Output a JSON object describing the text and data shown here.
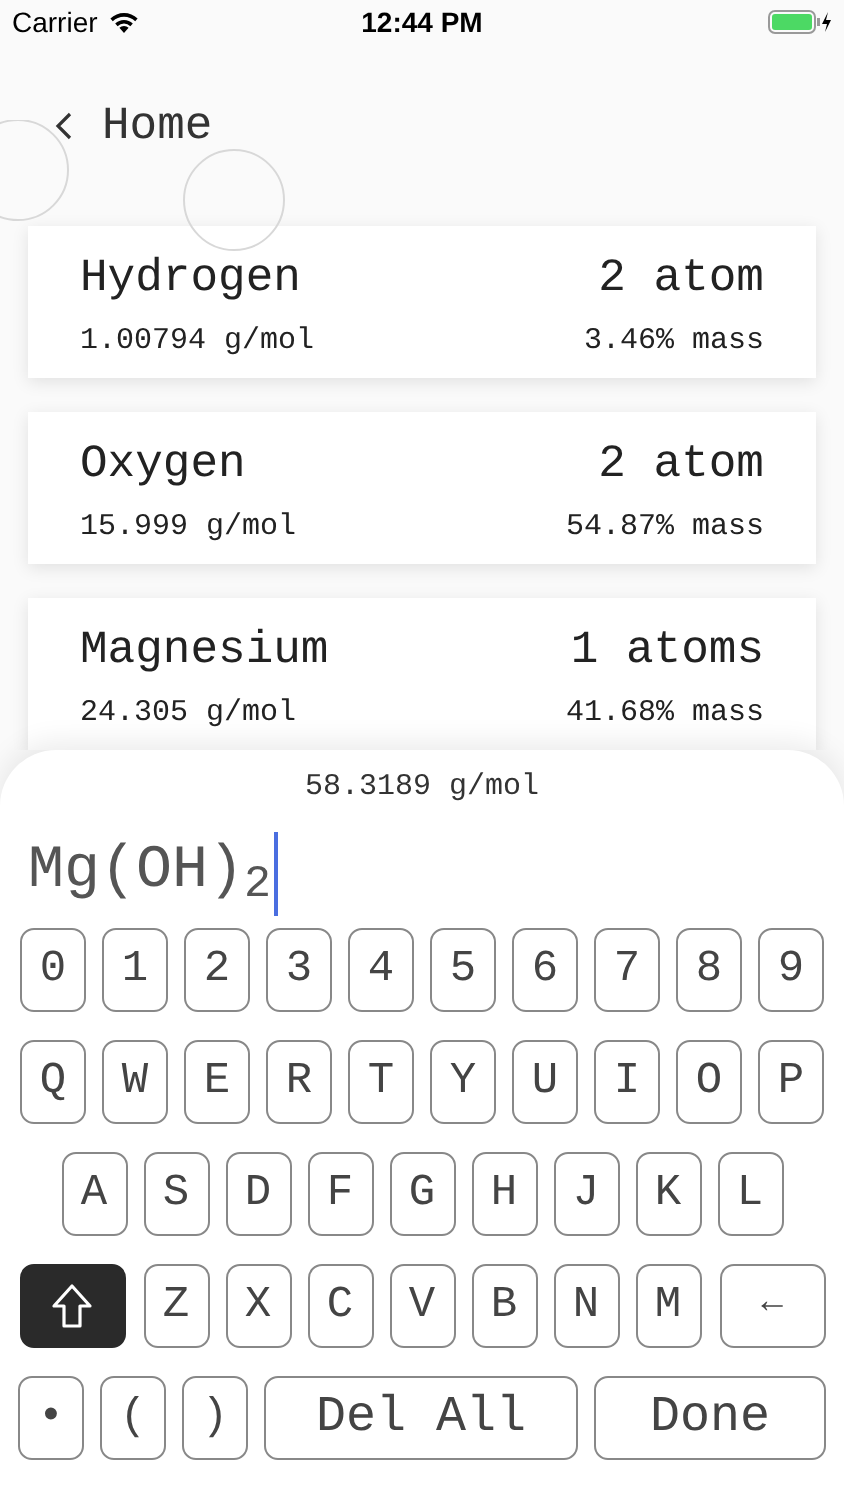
{
  "status_bar": {
    "carrier": "Carrier",
    "time": "12:44 PM"
  },
  "nav": {
    "back_label": "Home"
  },
  "elements": [
    {
      "name": "Hydrogen",
      "molar_mass": "1.00794 g/mol",
      "atoms": "2 atom",
      "mass_share": "3.46% mass"
    },
    {
      "name": "Oxygen",
      "molar_mass": "15.999 g/mol",
      "atoms": "2 atom",
      "mass_share": "54.87% mass"
    },
    {
      "name": "Magnesium",
      "molar_mass": "24.305 g/mol",
      "atoms": "1 atoms",
      "mass_share": "41.68% mass"
    }
  ],
  "total_mass": "58.3189 g/mol",
  "formula": "Mg(OH)$_{2}$",
  "keyboard": [
    [
      {
        "kind": "char",
        "label": "0"
      },
      {
        "kind": "char",
        "label": "1"
      },
      {
        "kind": "char",
        "label": "2"
      },
      {
        "kind": "char",
        "label": "3"
      },
      {
        "kind": "char",
        "label": "4"
      },
      {
        "kind": "char",
        "label": "5"
      },
      {
        "kind": "char",
        "label": "6"
      },
      {
        "kind": "char",
        "label": "7"
      },
      {
        "kind": "char",
        "label": "8"
      },
      {
        "kind": "char",
        "label": "9"
      }
    ],
    [
      {
        "kind": "char",
        "label": "Q"
      },
      {
        "kind": "char",
        "label": "W"
      },
      {
        "kind": "char",
        "label": "E"
      },
      {
        "kind": "char",
        "label": "R"
      },
      {
        "kind": "char",
        "label": "T"
      },
      {
        "kind": "char",
        "label": "Y"
      },
      {
        "kind": "char",
        "label": "U"
      },
      {
        "kind": "char",
        "label": "I"
      },
      {
        "kind": "char",
        "label": "O"
      },
      {
        "kind": "char",
        "label": "P"
      }
    ],
    [
      {
        "kind": "char",
        "label": "A"
      },
      {
        "kind": "char",
        "label": "S"
      },
      {
        "kind": "char",
        "label": "D"
      },
      {
        "kind": "char",
        "label": "F"
      },
      {
        "kind": "char",
        "label": "G"
      },
      {
        "kind": "char",
        "label": "H"
      },
      {
        "kind": "char",
        "label": "J"
      },
      {
        "kind": "char",
        "label": "K"
      },
      {
        "kind": "char",
        "label": "L"
      }
    ],
    [
      {
        "kind": "shift",
        "on": true
      },
      {
        "kind": "char",
        "label": "Z"
      },
      {
        "kind": "char",
        "label": "X"
      },
      {
        "kind": "char",
        "label": "C"
      },
      {
        "kind": "char",
        "label": "V"
      },
      {
        "kind": "char",
        "label": "B"
      },
      {
        "kind": "char",
        "label": "N"
      },
      {
        "kind": "char",
        "label": "M"
      },
      {
        "kind": "wide",
        "label": "←"
      }
    ],
    [
      {
        "kind": "char",
        "label": "•"
      },
      {
        "kind": "char",
        "label": "("
      },
      {
        "kind": "char",
        "label": ")"
      },
      {
        "kind": "action",
        "label": "Del All"
      },
      {
        "kind": "action",
        "label": "Done"
      }
    ]
  ]
}
